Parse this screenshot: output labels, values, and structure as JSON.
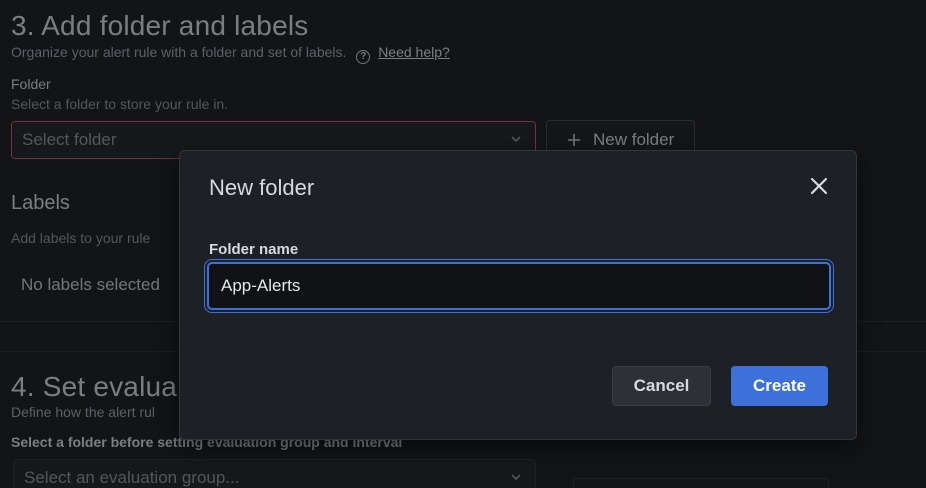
{
  "section3": {
    "title": "3. Add folder and labels",
    "description": "Organize your alert rule with a folder and set of labels.",
    "help_icon": "question-circle-icon",
    "help_link": "Need help?"
  },
  "folder": {
    "label": "Folder",
    "hint": "Select a folder to store your rule in.",
    "placeholder": "Select folder",
    "new_folder_button": "New folder"
  },
  "labels": {
    "title": "Labels",
    "hint": "Add labels to your rule",
    "empty_text": "No labels selected"
  },
  "section4": {
    "title": "4. Set evalua",
    "description": "Define how the alert rul",
    "group_label": "Select a folder before setting evaluation group and interval",
    "group_placeholder": "Select an evaluation group..."
  },
  "modal": {
    "title": "New folder",
    "field_label": "Folder name",
    "field_value": "App-Alerts",
    "cancel_button": "Cancel",
    "create_button": "Create"
  },
  "colors": {
    "primary": "#3d71d9",
    "error_border": "#d14d62",
    "background": "#181b1f"
  }
}
